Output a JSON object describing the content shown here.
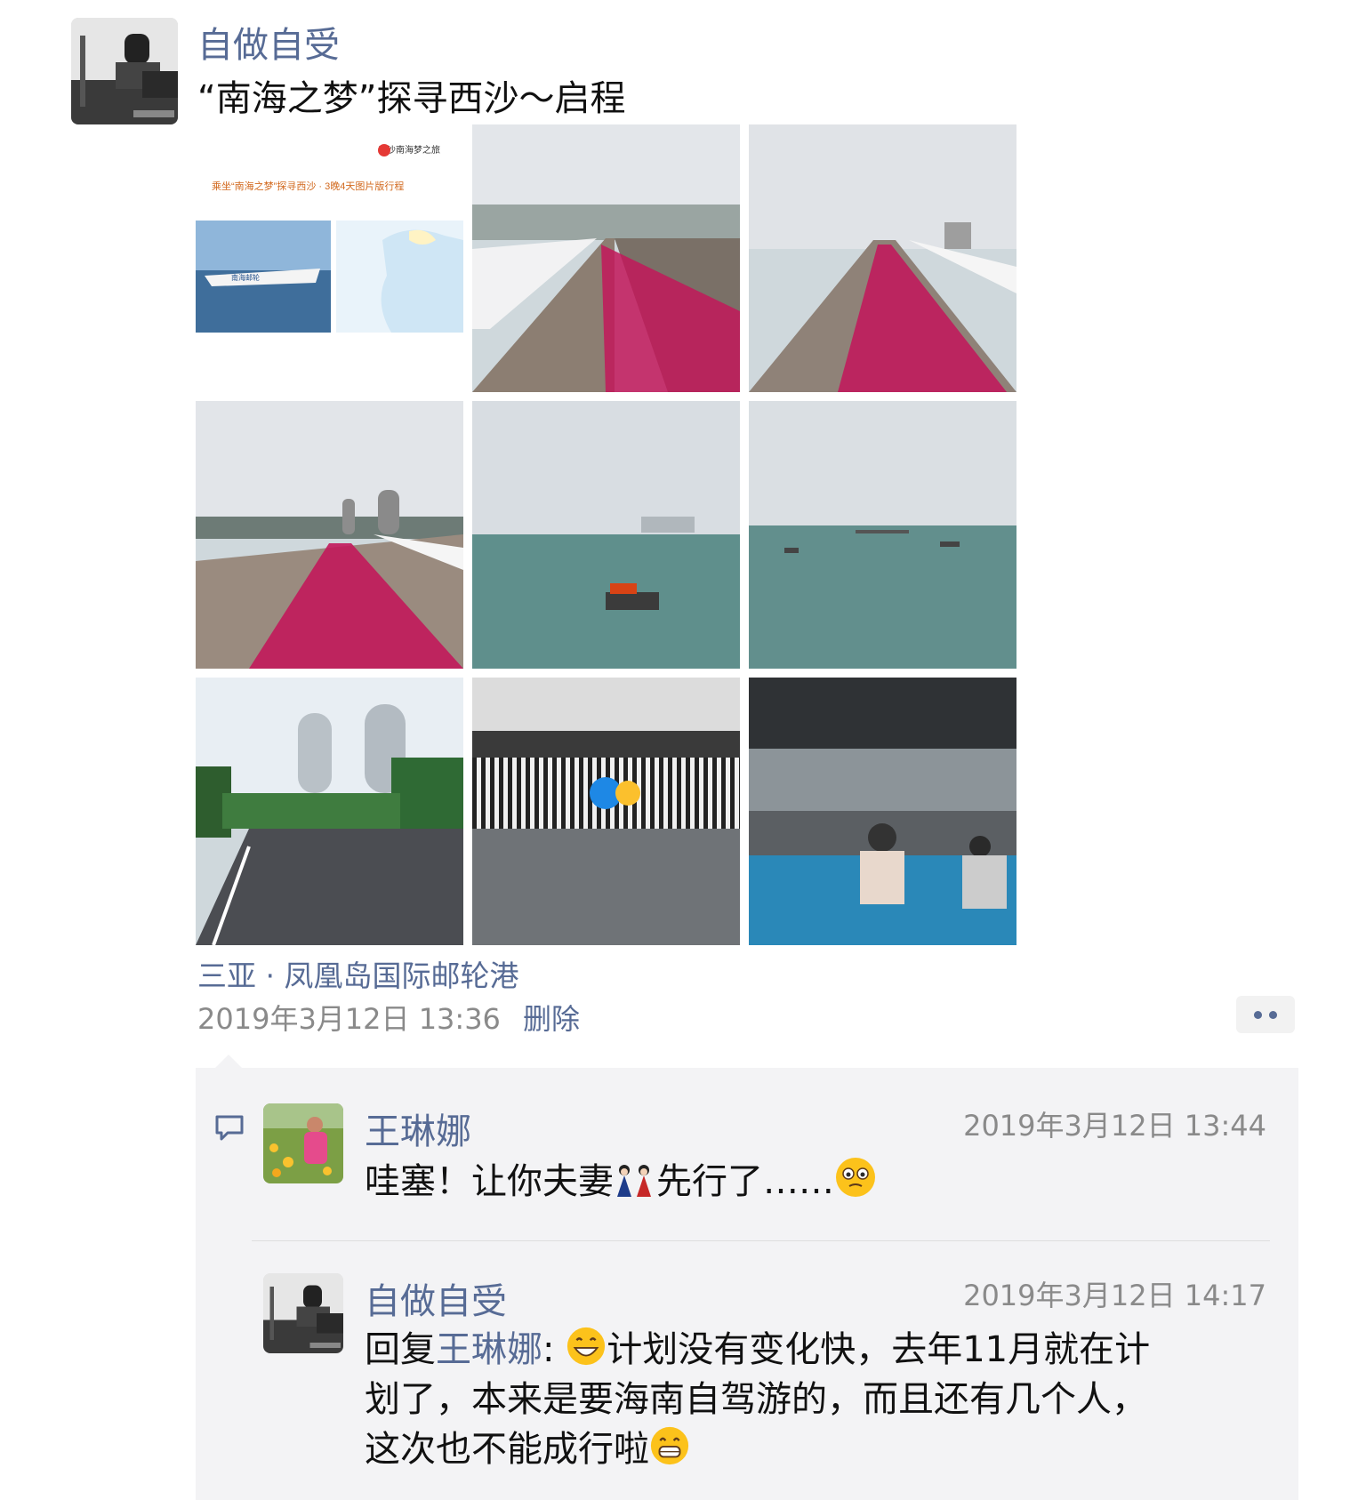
{
  "post": {
    "author": "自做自受",
    "text": "“南海之梦”探寻西沙～启程",
    "location": "三亚 · 凤凰岛国际邮轮港",
    "time": "2019年3月12日 13:36",
    "delete_label": "删除"
  },
  "photos": [
    {
      "icon": "itinerary-poster-image",
      "title": "乘坐“南海之梦”探寻西沙 · 3晚4天图片版行程",
      "brand": "三沙南海梦之旅",
      "ship_name": "南海邮轮"
    },
    {
      "icon": "flower-boardwalk-image"
    },
    {
      "icon": "flower-boardwalk-towers-image"
    },
    {
      "icon": "flower-walkway-phoenix-island-image"
    },
    {
      "icon": "sea-boat-image"
    },
    {
      "icon": "sea-boats-image"
    },
    {
      "icon": "road-towers-image"
    },
    {
      "icon": "terminal-entrance-image"
    },
    {
      "icon": "terminal-waiting-hall-image"
    }
  ],
  "comments": [
    {
      "author": "王琳娜",
      "time": "2019年3月12日 13:44",
      "text": "哇塞！让你夫妻",
      "text_after_emoji": "先行了……"
    },
    {
      "author": "自做自受",
      "time": "2019年3月12日 14:17",
      "reply_prefix": "回复",
      "reply_to": "王琳娜",
      "reply_sep": ":",
      "line1": "计划没有变化快，去年11月就在计",
      "line2": "划了，本来是要海南自驾游的，而且还有几个人，",
      "line3": "这次也不能成行啦"
    }
  ],
  "colors": {
    "link": "#576b95",
    "meta": "#8a8a8a",
    "panel": "#f3f3f5"
  }
}
